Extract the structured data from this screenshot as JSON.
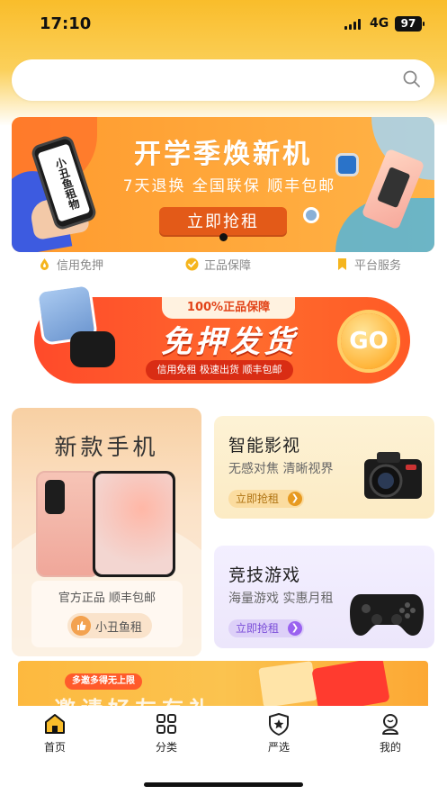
{
  "status_bar": {
    "time": "17:10",
    "network": "4G",
    "battery": "97"
  },
  "search": {
    "placeholder": ""
  },
  "banner": {
    "title": "开学季焕新机",
    "subtitle": "7天退换 全国联保 顺丰包邮",
    "cta": "立即抢租",
    "device_text": "小丑鱼租物"
  },
  "guarantees": [
    {
      "label": "信用免押",
      "icon": "drop-icon"
    },
    {
      "label": "正品保障",
      "icon": "check-badge-icon"
    },
    {
      "label": "平台服务",
      "icon": "bookmark-icon"
    }
  ],
  "promo": {
    "top_label": "100%正品保障",
    "title": "免押发货",
    "strip": "信用免租 极速出货 顺丰包邮",
    "go": "GO"
  },
  "cards": {
    "phone": {
      "title": "新款手机",
      "desc": "官方正品 顺丰包邮",
      "badge": "小丑鱼租"
    },
    "video": {
      "title": "智能影视",
      "desc": "无感对焦 清晰视界",
      "button": "立即抢租"
    },
    "game": {
      "title": "竞技游戏",
      "desc": "海量游戏 实惠月租",
      "button": "立即抢租"
    }
  },
  "invite": {
    "tag": "多邀多得无上限",
    "text": "邀请好友有礼"
  },
  "tabbar": [
    {
      "label": "首页",
      "icon": "home-icon",
      "active": true
    },
    {
      "label": "分类",
      "icon": "grid-icon",
      "active": false
    },
    {
      "label": "严选",
      "icon": "star-shield-icon",
      "active": false
    },
    {
      "label": "我的",
      "icon": "user-icon",
      "active": false
    }
  ],
  "colors": {
    "brand": "#f9bd2b",
    "accent_orange": "#ff6a2d",
    "cta": "#e35a18"
  }
}
